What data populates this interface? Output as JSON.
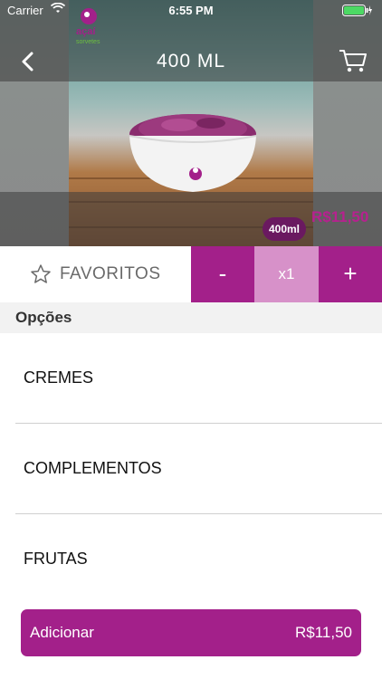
{
  "status_bar": {
    "carrier": "Carrier",
    "time": "6:55 PM",
    "wifi_icon": "wifi-icon",
    "battery_icon": "battery-icon"
  },
  "nav": {
    "title": "400 ML",
    "back_icon": "chevron-left-icon",
    "cart_icon": "cart-icon"
  },
  "brand": {
    "logo_text": "açaí sorvetes",
    "logo_icon": "acai-logo"
  },
  "product": {
    "size_badge": "400ml",
    "price": "R$11,50"
  },
  "actions": {
    "favorite_label": "FAVORITOS",
    "favorite_icon": "star-icon",
    "minus_label": "-",
    "quantity": "x1",
    "plus_label": "+"
  },
  "options": {
    "header": "Opções",
    "items": [
      {
        "label": "CREMES"
      },
      {
        "label": "COMPLEMENTOS"
      },
      {
        "label": "FRUTAS"
      }
    ]
  },
  "add_button": {
    "label": "Adicionar",
    "price": "R$11,50"
  },
  "colors": {
    "accent": "#a3208a",
    "accent_light": "#d791c9",
    "price": "#b7218f",
    "badge": "#6a1960"
  }
}
